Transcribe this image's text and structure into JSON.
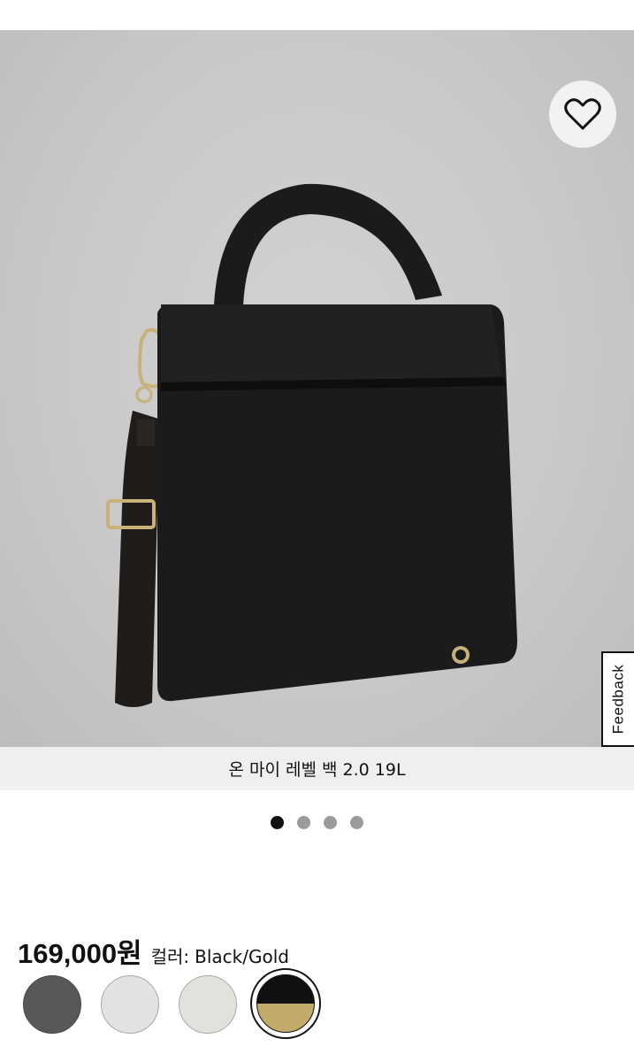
{
  "product": {
    "name": "온 마이 레벨 백 2.0 19L",
    "price": "169,000원",
    "color_label": "컬러:",
    "color_value": "Black/Gold"
  },
  "gallery": {
    "image_count": 4,
    "active_index": 0
  },
  "feedback_tab": {
    "label": "Feedback"
  },
  "icons": {
    "wishlist": "heart-icon"
  },
  "swatches": [
    {
      "name": "gray",
      "color": "#5a5856",
      "selected": false
    },
    {
      "name": "light-gray",
      "color": "#e1e2e4",
      "selected": false
    },
    {
      "name": "bone",
      "color": "#e3e1dc",
      "selected": false
    },
    {
      "name": "black-gold",
      "colors": [
        "#111111",
        "#c2ab6a"
      ],
      "selected": true
    }
  ],
  "colors": {
    "background": "#c9c9ca",
    "caption_bg": "#efefef",
    "accent": "#111111"
  }
}
